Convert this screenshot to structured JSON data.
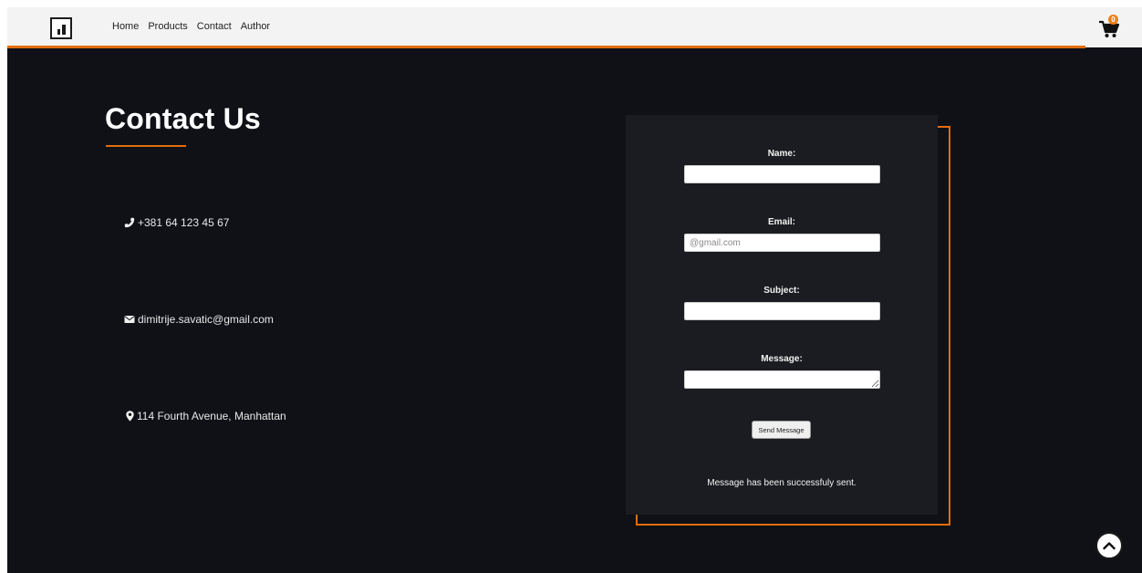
{
  "nav": {
    "links": [
      "Home",
      "Products",
      "Contact",
      "Author"
    ],
    "cart_count": "0"
  },
  "contact": {
    "title": "Contact Us",
    "phone": "+381 64 123 45 67",
    "email": "dimitrije.savatic@gmail.com",
    "address": "114 Fourth Avenue, Manhattan"
  },
  "form": {
    "name_label": "Name:",
    "name_value": "",
    "email_label": "Email:",
    "email_placeholder": "@gmail.com",
    "subject_label": "Subject:",
    "subject_value": "",
    "message_label": "Message:",
    "message_value": "",
    "send_label": "Send Message",
    "success_text": "Message has been successfuly sent."
  },
  "colors": {
    "accent": "#e26d0e",
    "background": "#0f1117",
    "card": "#1a1c21",
    "nav_bg": "#f3f3f3"
  },
  "icons": [
    "logo-chart-icon",
    "shopping-cart-icon",
    "phone-icon",
    "envelope-icon",
    "map-marker-icon",
    "chevron-up-icon"
  ]
}
